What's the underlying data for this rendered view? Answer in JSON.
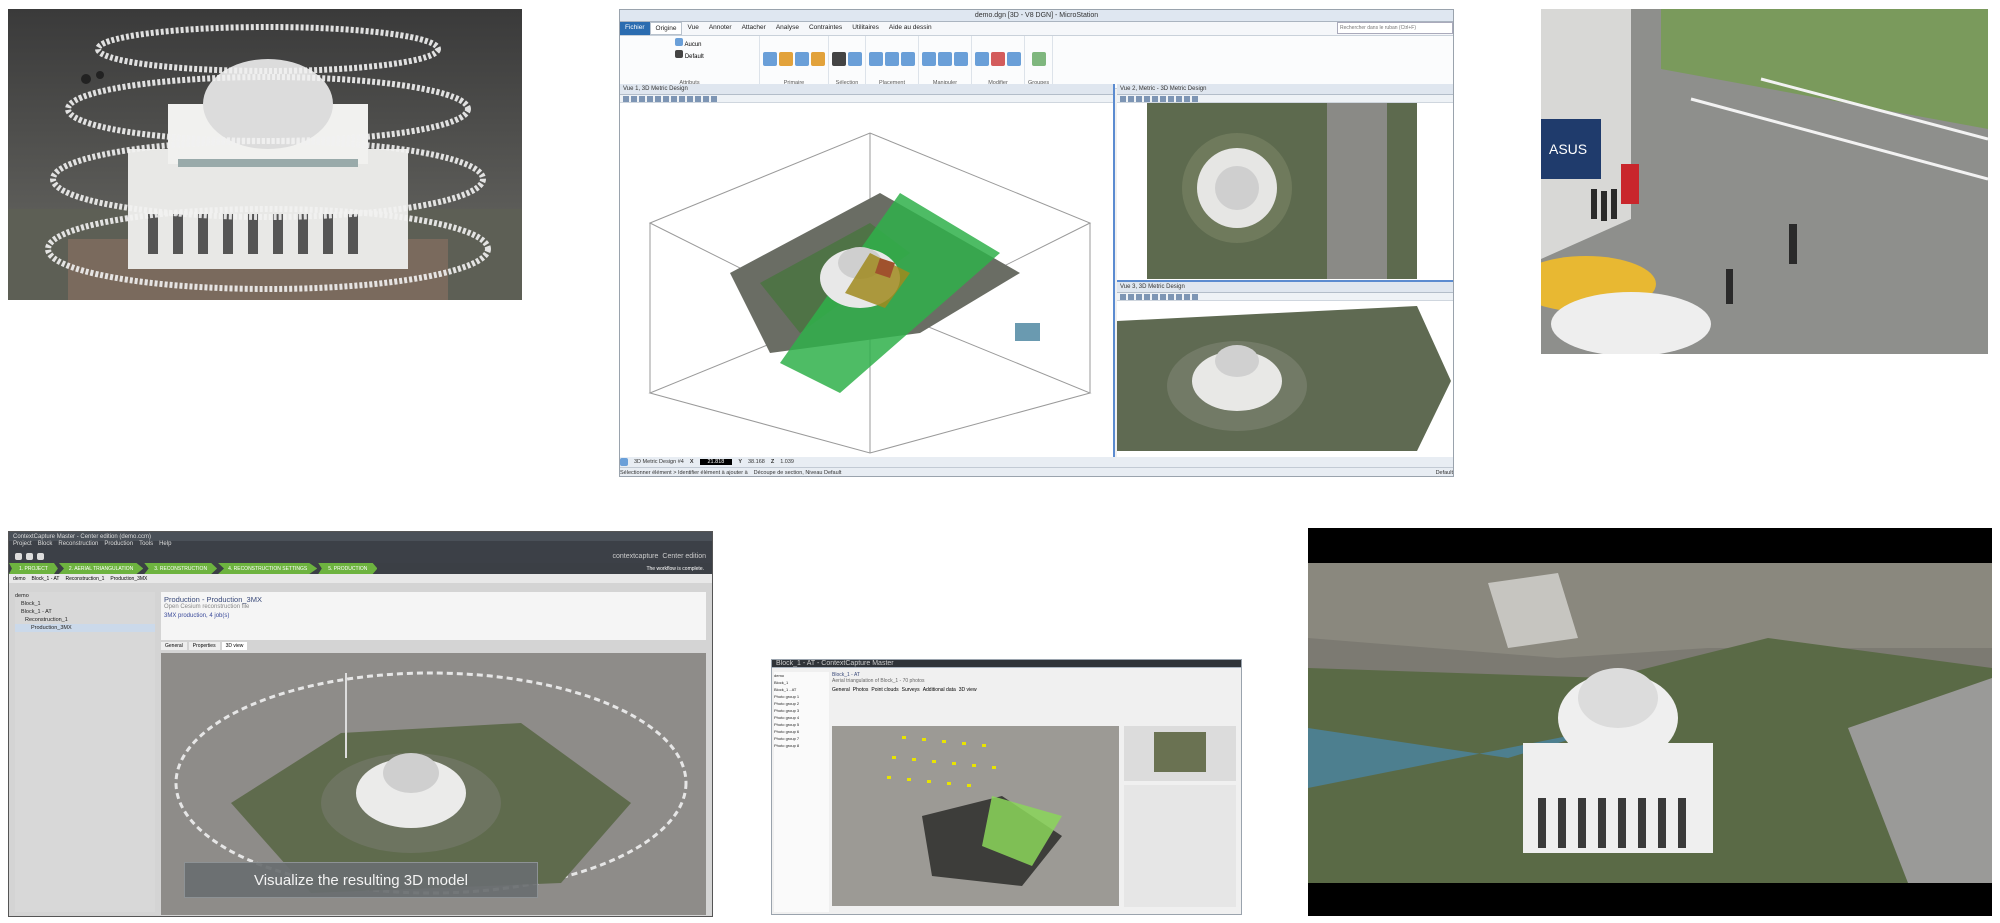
{
  "microstation": {
    "titlebar": "demo.dgn [3D - V8 DGN] - MicroStation",
    "search_placeholder": "Rechercher dans le ruban (Ctrl+F)",
    "ribbon_tabs": [
      "Fichier",
      "Origine",
      "Vue",
      "Annoter",
      "Attacher",
      "Analyse",
      "Contraintes",
      "Utilitaires",
      "Aide au dessin"
    ],
    "active_tab": "Origine",
    "level_value": "Aucun",
    "style_value": "Default",
    "groups": [
      {
        "label": "Attributs",
        "tools": []
      },
      {
        "label": "Primaire",
        "tools": [
          "Explorer",
          "Attacher (outils)",
          "Modèles",
          "Affichage Niveaux"
        ]
      },
      {
        "label": "Sélection",
        "tools": [
          "Sélectionner élément",
          "Outils de clôture"
        ]
      },
      {
        "label": "Placement",
        "tools": [
          "Outils ligne",
          "Outils arc",
          "Outils polygone"
        ]
      },
      {
        "label": "Manipuler",
        "tools": [
          "Déplacer",
          "Copier",
          "Rotation"
        ]
      },
      {
        "label": "Modifier",
        "tools": [
          "Modifier élément",
          "Casser élément",
          "Couper multiples"
        ]
      },
      {
        "label": "Groupes",
        "tools": [
          "Créer Région"
        ]
      }
    ],
    "view1_title": "Vue 1, 3D Metric Design",
    "view2_title": "Vue 2, Metric - 3D Metric Design",
    "view3_title": "Vue 3, 3D Metric Design",
    "view_selector": "3D Metric Design #4",
    "coord_x_label": "X",
    "coord_x_value": "21.818",
    "coord_y_label": "Y",
    "coord_y_value": "38.168",
    "coord_z_label": "Z",
    "coord_z_value": "1.039",
    "status_left": "Sélectionner élément > Identifier élément à ajouter à",
    "status_mid": "Découpe de section, Niveau Default",
    "status_level": "Default"
  },
  "contextcapture": {
    "titlebar": "ContextCapture Master - Center edition (demo.ccm)",
    "menu": [
      "Project",
      "Block",
      "Reconstruction",
      "Production",
      "Tools",
      "Help"
    ],
    "steps": [
      "1. PROJECT",
      "2. AERIAL TRIANGULATION",
      "3. RECONSTRUCTION",
      "4. RECONSTRUCTION SETTINGS",
      "5. PRODUCTION"
    ],
    "brand": "contextcapture",
    "edition": "Center edition",
    "completion": "The workflow is complete.",
    "breadcrumb": [
      "demo",
      "Block_1 - AT",
      "Reconstruction_1",
      "Production_3MX"
    ],
    "tree": [
      "demo",
      "Block_1",
      "Block_1 - AT",
      "Reconstruction_1",
      "Production_3MX"
    ],
    "heading": "Production - Production_3MX",
    "subheading": "Open Cesium reconstruction file",
    "link": "3MX production, 4 job(s)",
    "tabs": [
      "General",
      "Properties",
      "3D view"
    ],
    "caption": "Visualize the resulting 3D model"
  },
  "acute": {
    "titlebar": "Block_1 - AT - ContextCapture Master",
    "heading": "Block_1 - AT",
    "info": "Aerial triangulation of Block_1 - 70 photos",
    "tabs": [
      "General",
      "Photos",
      "Point clouds",
      "Surveys",
      "Additional data",
      "3D view"
    ],
    "tree_items": [
      "demo",
      "Block_1",
      "Block_1 - AT",
      "Photo group 1",
      "Photo group 2",
      "Photo group 3",
      "Photo group 4",
      "Photo group 5",
      "Photo group 6",
      "Photo group 7",
      "Photo group 8"
    ]
  },
  "street": {
    "sign": "ASUS"
  }
}
